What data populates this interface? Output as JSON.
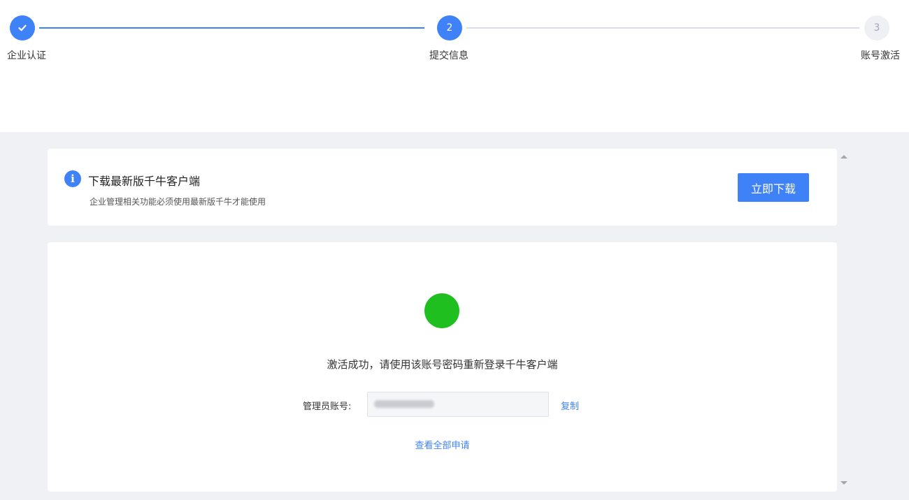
{
  "stepper": {
    "steps": [
      {
        "number": "",
        "label": "企业认证",
        "state": "done"
      },
      {
        "number": "2",
        "label": "提交信息",
        "state": "active"
      },
      {
        "number": "3",
        "label": "账号激活",
        "state": "pending"
      }
    ]
  },
  "notice": {
    "title": "下载最新版千牛客户端",
    "description": "企业管理相关功能必须使用最新版千牛才能使用",
    "button_label": "立即下载"
  },
  "result": {
    "message": "激活成功，请使用该账号密码重新登录千牛客户端",
    "account_label": "管理员账号:",
    "account_value": "",
    "copy_label": "复制",
    "view_all_label": "查看全部申请"
  },
  "colors": {
    "primary": "#3f82f7",
    "success": "#1fbf1f",
    "background": "#f0f1f4"
  },
  "icons": {
    "step_done": "check-icon",
    "notice": "info-icon",
    "result": "success-circle-icon"
  }
}
